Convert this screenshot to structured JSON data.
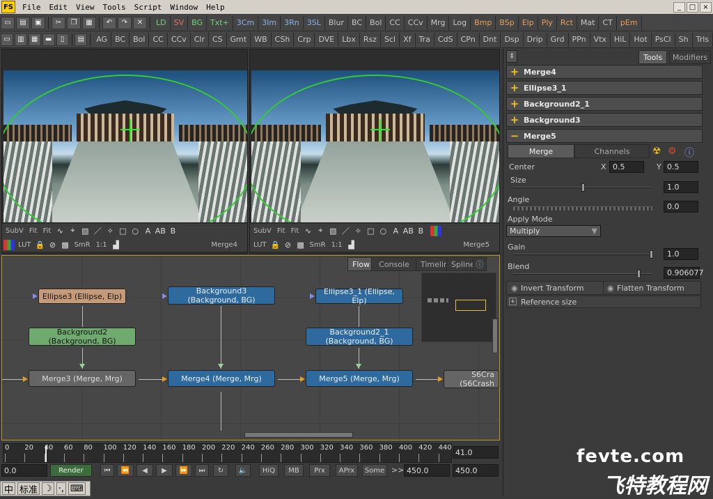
{
  "menubar": {
    "logo": "FS",
    "items": [
      "File",
      "Edit",
      "View",
      "Tools",
      "Script",
      "Window",
      "Help"
    ],
    "window_controls": [
      "_",
      "□",
      "×"
    ]
  },
  "toolbar1": {
    "items": [
      "LD",
      "SV",
      "BG",
      "Txt+",
      "3Cm",
      "3Im",
      "3Rn",
      "3SL",
      "Blur",
      "BC",
      "Bol",
      "CC",
      "CCv",
      "Mrg",
      "Log",
      "Bmp",
      "BSp",
      "Elp",
      "Ply",
      "Rct",
      "Mat",
      "CT",
      "pEm"
    ],
    "colors": {
      "LD": "#7ad07a",
      "SV": "#e07070",
      "BG": "#7ad07a",
      "Txt+": "#7ad07a",
      "3Cm": "#8fb3e6",
      "3Im": "#8fb3e6",
      "3Rn": "#8fb3e6",
      "3SL": "#8fb3e6",
      "Bmp": "#e8a060",
      "BSp": "#e8a060",
      "Elp": "#e8a060",
      "Ply": "#e8a060",
      "Rct": "#e8a060",
      "pEm": "#e8a060"
    }
  },
  "toolbar2": {
    "items": [
      "AG",
      "BC",
      "Bol",
      "CC",
      "CCv",
      "Clr",
      "CS",
      "Gmt",
      "WB",
      "CSh",
      "Crp",
      "DVE",
      "Lbx",
      "Rsz",
      "Scl",
      "Xf",
      "Tra",
      "CdS",
      "CPn",
      "Dnt",
      "Dsp",
      "Drip",
      "Grd",
      "PPn",
      "Vtx",
      "HiL",
      "Hot",
      "PsCl",
      "Sh",
      "Trls"
    ]
  },
  "viewers": [
    {
      "label": "Merge4",
      "subv": "SubV",
      "fit": "Fit",
      "lut": "LUT",
      "smr": "SmR",
      "ratio": "1:1"
    },
    {
      "label": "Merge5",
      "subv": "SubV",
      "fit": "Fit",
      "lut": "LUT",
      "smr": "SmR",
      "ratio": "1:1"
    }
  ],
  "viewer_glyphs": {
    "a": "A",
    "ab": "AB",
    "b": "B"
  },
  "flow": {
    "tabs": [
      "Flow",
      "Console",
      "Timeline",
      "Spline"
    ],
    "active_tab": "Flow",
    "nodes": [
      {
        "l1": "Ellipse3  (Ellipse, Elp)",
        "l2": ""
      },
      {
        "l1": "Background3",
        "l2": "(Background, BG)"
      },
      {
        "l1": "Ellipse3_1  (Ellipse, Elp)",
        "l2": ""
      },
      {
        "l1": "Background2",
        "l2": "(Background, BG)"
      },
      {
        "l1": "Background2_1",
        "l2": "(Background, BG)"
      },
      {
        "l1": "Merge3  (Merge, Mrg)",
        "l2": ""
      },
      {
        "l1": "Merge4  (Merge, Mrg)",
        "l2": ""
      },
      {
        "l1": "Merge5  (Merge, Mrg)",
        "l2": ""
      },
      {
        "l1": "S6Cra",
        "l2": "(S6Crash"
      }
    ]
  },
  "timeline": {
    "ticks": [
      "0",
      "20",
      "40",
      "60",
      "80",
      "100",
      "120",
      "140",
      "160",
      "180",
      "200",
      "220",
      "240",
      "260",
      "280",
      "300",
      "320",
      "340",
      "360",
      "380",
      "400",
      "420",
      "440"
    ],
    "current_time": "41.0",
    "start_time": "0.0",
    "render_label": "Render",
    "buttons": [
      "HiQ",
      "MB",
      "Prx",
      "APrx",
      "Some"
    ],
    "range_marker": ">>",
    "end_time": "450.0",
    "global_end": "450.0"
  },
  "panel": {
    "tabs": [
      "Tools",
      "Modifiers"
    ],
    "active_tab": "Tools",
    "tools": [
      "Merge4",
      "Ellipse3_1",
      "Background2_1",
      "Background3",
      "Merge5"
    ],
    "expanded_tool": "Merge5",
    "subtabs": [
      "Merge",
      "Channels"
    ],
    "center_label": "Center",
    "center_x_label": "X",
    "center_x": "0.5",
    "center_y_label": "Y",
    "center_y": "0.5",
    "size_label": "Size",
    "size": "1.0",
    "size_level": 0.5,
    "angle_label": "Angle",
    "angle": "0.0",
    "apply_mode_label": "Apply Mode",
    "apply_mode": "Multiply",
    "gain_label": "Gain",
    "gain": "1.0",
    "gain_level": 1.0,
    "blend_label": "Blend",
    "blend": "0.906077",
    "blend_level": 0.906,
    "invert_transform": "Invert Transform",
    "flatten_transform": "Flatten Transform",
    "reference_size": "Reference size"
  },
  "ime": {
    "items": [
      "中",
      "标准",
      "☽",
      "·,",
      "⌨"
    ]
  },
  "watermark": {
    "line1": "fevte.com",
    "line2": "飞特教程网"
  }
}
